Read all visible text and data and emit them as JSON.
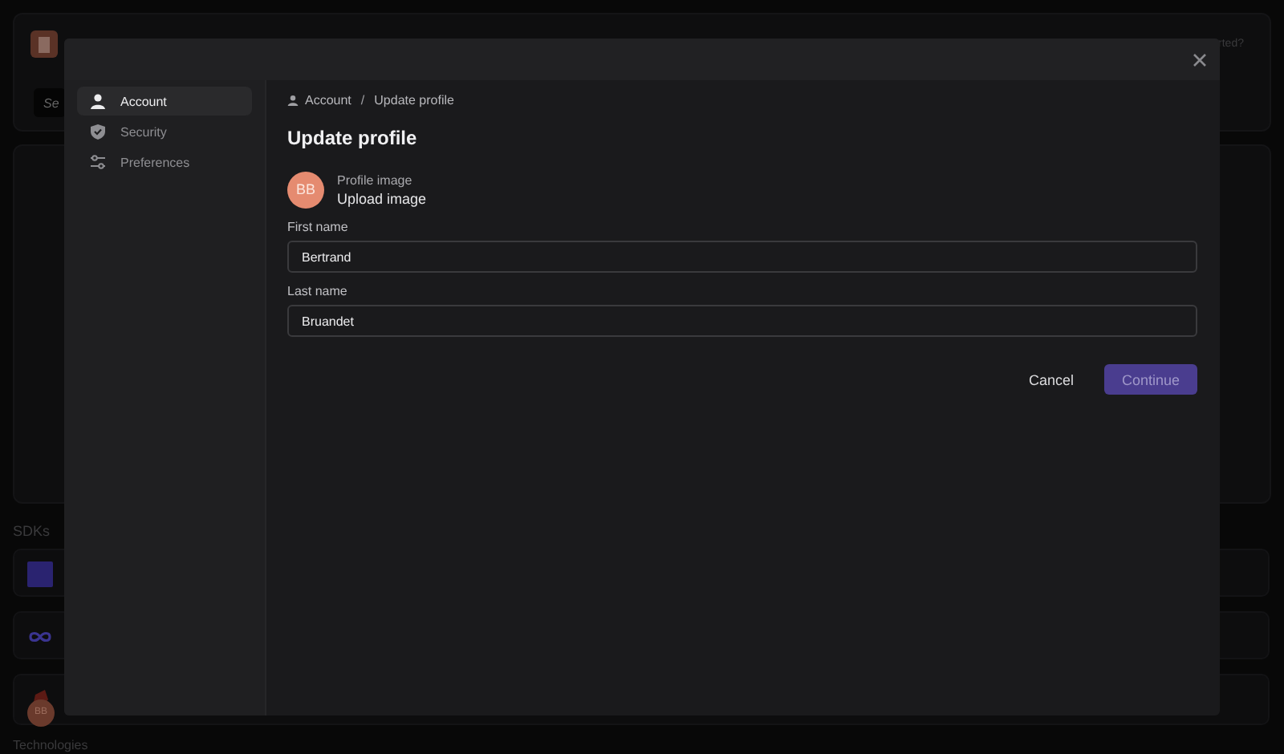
{
  "background": {
    "search": {
      "placeholder": "Se"
    },
    "help_text": "rted?",
    "sections": [
      {
        "title": "SDKs",
        "items": [
          {
            "kind": "square"
          },
          {
            "kind": "loop"
          },
          {
            "kind": "figure"
          }
        ]
      },
      {
        "title": "Technologies"
      }
    ],
    "avatar": {
      "initials": "BB"
    }
  },
  "dialog": {
    "sidebar": {
      "items": [
        {
          "label": "Account",
          "selected": true
        },
        {
          "label": "Security",
          "selected": false
        },
        {
          "label": "Preferences",
          "selected": false
        }
      ]
    },
    "breadcrumb": {
      "separator": "/",
      "items": [
        "Account",
        "Update profile"
      ]
    },
    "title": "Update profile",
    "profile_image": {
      "initials": "BB",
      "label": "Profile image",
      "action": "Upload image"
    },
    "fields": [
      {
        "label": "First name",
        "value": "Bertrand"
      },
      {
        "label": "Last name",
        "value": "Bruandet"
      }
    ],
    "buttons": [
      {
        "label": "Cancel",
        "kind": "text"
      },
      {
        "label": "Continue",
        "kind": "primary"
      }
    ]
  }
}
